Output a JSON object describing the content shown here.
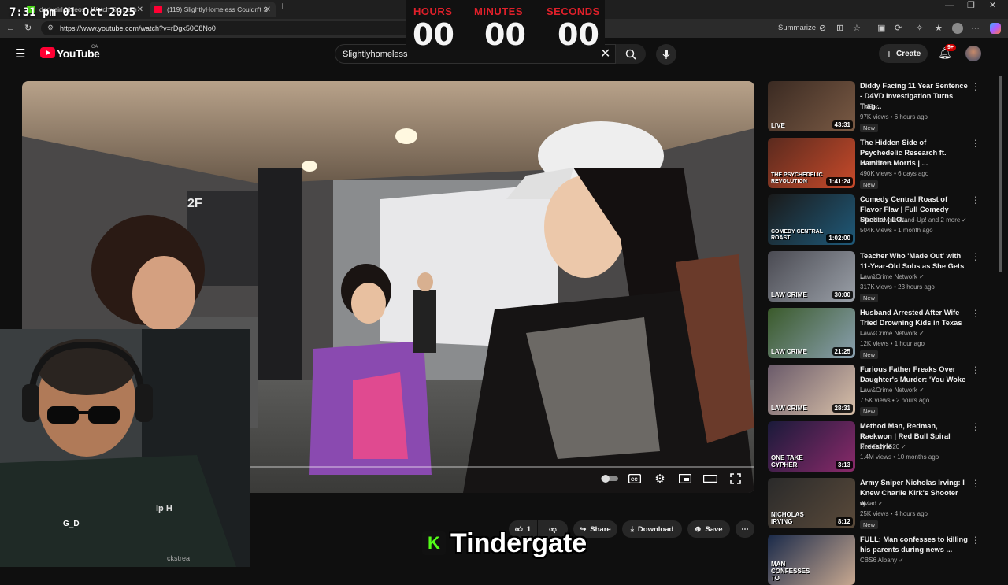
{
  "browser": {
    "tabs": [
      {
        "title": "dariusirl Videos - Watch On-Dem",
        "favicon_color": "#53fc18"
      },
      {
        "title": "(119) SlightlyHomeless Couldn't S",
        "favicon_color": "#ff0033"
      }
    ],
    "new_tab": "+",
    "url": "https://www.youtube.com/watch?v=rDgx50C8No0",
    "summarize_label": "Summarize"
  },
  "clock": "7:31 pm  01 Oct 2025",
  "timer": {
    "hours_label": "HOURS",
    "minutes_label": "MINUTES",
    "seconds_label": "SECONDS",
    "hours": "00",
    "minutes": "00",
    "seconds": "00"
  },
  "youtube": {
    "logo_text": "YouTube",
    "region": "CA",
    "search_value": "Slightlyhomeless",
    "create_label": "Create",
    "notifications_badge": "9+"
  },
  "video": {
    "sign_text": "2F",
    "like_count": "1",
    "share_label": "Share",
    "download_label": "Download",
    "save_label": "Save"
  },
  "webcam_fragments": {
    "line1": "lp H",
    "line2": "G_D",
    "line3": "ckstrea"
  },
  "caption": {
    "badge": "K",
    "text": "Tindergate"
  },
  "recommendations": [
    {
      "title": "Diddy Facing 11 Year Sentence - D4VD Investigation Turns Trag...",
      "channel": "TMZ",
      "meta": "97K views • 6 hours ago",
      "badge": "New",
      "duration": "43:31",
      "tag": "LIVE",
      "colors": [
        "#3a2a22",
        "#7a5a44"
      ]
    },
    {
      "title": "The Hidden Side of Psychedelic Research ft. Hamilton Morris | ...",
      "channel": "VICE News",
      "meta": "490K views • 6 days ago",
      "badge": "New",
      "duration": "1:41:24",
      "tag": "THE PSYCHEDELIC REVOLUTION",
      "colors": [
        "#5a2a1e",
        "#c84a2a"
      ]
    },
    {
      "title": "Comedy Central Roast of Flavor Flav | Full Comedy Special | LO...",
      "channel": "LOL Network Stand-Up! and 2 more",
      "meta": "504K views • 1 month ago",
      "badge": "",
      "duration": "1:02:00",
      "tag": "COMEDY CENTRAL ROAST",
      "colors": [
        "#1a1a1a",
        "#1f5a7a"
      ]
    },
    {
      "title": "Teacher Who 'Made Out' with 11-Year-Old Sobs as She Gets ...",
      "channel": "Law&Crime Network",
      "meta": "317K views • 23 hours ago",
      "badge": "New",
      "duration": "30:00",
      "tag": "LAW CRIME",
      "colors": [
        "#4a4a52",
        "#9aa0a8"
      ]
    },
    {
      "title": "Husband Arrested After Wife Tried Drowning Kids in Texas ...",
      "channel": "Law&Crime Network",
      "meta": "12K views • 1 hour ago",
      "badge": "New",
      "duration": "21:25",
      "tag": "LAW CRIME",
      "colors": [
        "#3a5a2a",
        "#8aa0b0"
      ]
    },
    {
      "title": "Furious Father Freaks Over Daughter's Murder: 'You Woke ...",
      "channel": "Law&Crime Network",
      "meta": "7.5K views • 2 hours ago",
      "badge": "New",
      "duration": "28:31",
      "tag": "LAW CRIME",
      "colors": [
        "#6a5a6a",
        "#d8c0a8"
      ]
    },
    {
      "title": "Method Man, Redman, Raekwon | Red Bull Spiral Freestyle",
      "channel": "Red Bull 1520",
      "meta": "1.4M views • 10 months ago",
      "badge": "",
      "duration": "3:13",
      "tag": "ONE TAKE CYPHER",
      "colors": [
        "#1a1a3a",
        "#8a2a6a"
      ]
    },
    {
      "title": "Army Sniper Nicholas Irving: I Knew Charlie Kirk's Shooter w...",
      "channel": "djvlad",
      "meta": "25K views • 4 hours ago",
      "badge": "New",
      "duration": "8:12",
      "tag": "NICHOLAS IRVING",
      "colors": [
        "#2a2a2a",
        "#5a4a3a"
      ]
    },
    {
      "title": "FULL: Man confesses to killing his parents during news ...",
      "channel": "CBS6 Albany",
      "meta": "",
      "badge": "",
      "duration": "",
      "tag": "MAN CONFESSES TO",
      "colors": [
        "#1a2a4a",
        "#c8a890"
      ]
    }
  ]
}
